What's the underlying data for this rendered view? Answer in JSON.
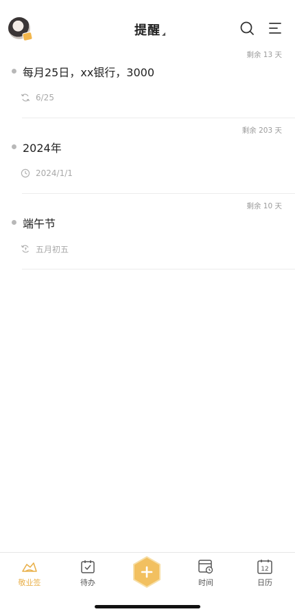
{
  "header": {
    "title": "提醒",
    "avatar_icon": "user-avatar",
    "search_icon": "search-icon",
    "menu_icon": "menu-icon"
  },
  "reminders": [
    {
      "title": "每月25日，xx银行，3000",
      "remaining": "剩余 13 天",
      "meta_icon": "repeat-icon",
      "meta_text": "6/25"
    },
    {
      "title": "2024年",
      "remaining": "剩余 203 天",
      "meta_icon": "clock-icon",
      "meta_text": "2024/1/1"
    },
    {
      "title": "端午节",
      "remaining": "剩余 10 天",
      "meta_icon": "lunar-repeat-icon",
      "meta_text": "五月初五"
    }
  ],
  "tabbar": {
    "tabs": [
      {
        "label": "敬业签",
        "icon": "note-icon",
        "active": true
      },
      {
        "label": "待办",
        "icon": "todo-icon",
        "active": false
      },
      {
        "label": "",
        "icon": "add-icon",
        "active": false
      },
      {
        "label": "时间",
        "icon": "time-icon",
        "active": false
      },
      {
        "label": "日历",
        "icon": "calendar-icon",
        "active": false
      }
    ],
    "calendar_day": "12"
  },
  "colors": {
    "accent": "#e9b04a",
    "add_button": "#f2c060",
    "text_primary": "#222222",
    "text_secondary": "#a8a8a8"
  }
}
